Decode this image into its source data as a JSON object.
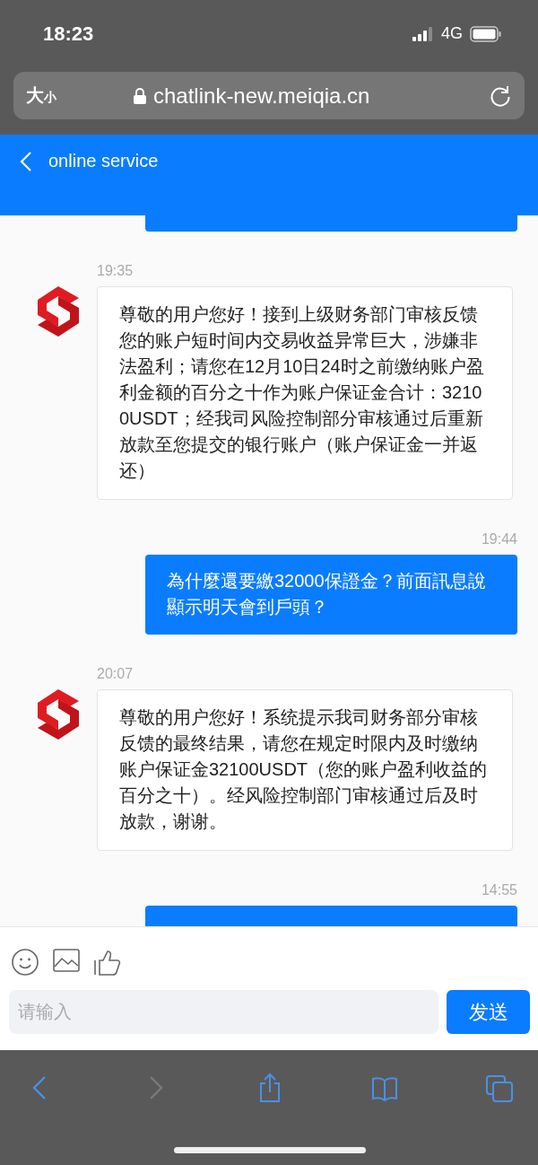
{
  "status_bar": {
    "time": "18:23",
    "network": "4G"
  },
  "url_bar": {
    "text_size": "大$_{小}$",
    "url": "chatlink-new.meiqia.cn"
  },
  "header": {
    "title": "online service"
  },
  "messages": [
    {
      "kind": "user"
    },
    {
      "kind": "agent",
      "time": "19:35",
      "text": "尊敬的用户您好！接到上级财务部门审核反馈您的账户短时间内交易收益异常巨大，涉嫌非法盈利；请您在12月10日24时之前缴纳账户盈利金额的百分之十作为账户保证金合计：32100USDT；经我司风险控制部分审核通过后重新放款至您提交的银行账户（账户保证金一并返还）"
    },
    {
      "kind": "user",
      "time": "19:44",
      "text": "為什麼還要繳32000保證金？前面訊息說顯示明天會到戶頭？"
    },
    {
      "kind": "agent",
      "time": "20:07",
      "text": "尊敬的用户您好！系统提示我司财务部分审核反馈的最终结果，请您在规定时限内及时缴纳账户保证金32100USDT（您的账户盈利收益的百分之十）。经风险控制部门审核通过后及时放款，谢谢。"
    },
    {
      "kind": "user",
      "time": "14:55"
    }
  ],
  "composer": {
    "placeholder": "请输入",
    "send": "发送"
  },
  "toolbar": [
    {
      "kind": "back",
      "disabled": false
    },
    {
      "kind": "forward",
      "disabled": true
    },
    {
      "kind": "share",
      "disabled": false
    },
    {
      "kind": "bookmarks",
      "disabled": false
    },
    {
      "kind": "tabs",
      "disabled": false
    }
  ]
}
